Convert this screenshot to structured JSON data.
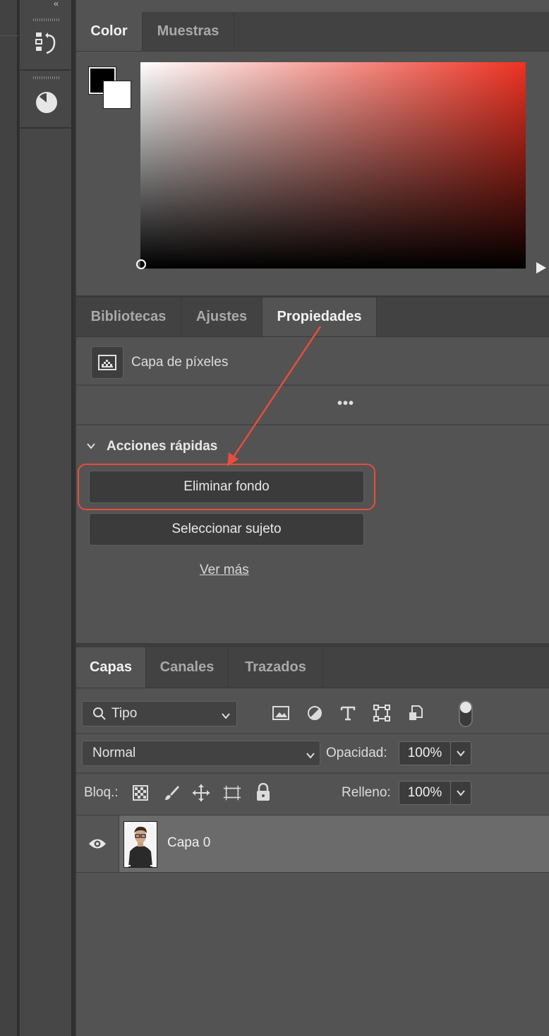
{
  "dock": {
    "icons": [
      "history-icon",
      "color-wheel-icon"
    ]
  },
  "color_panel": {
    "tabs": [
      "Color",
      "Muestras"
    ],
    "active_tab": "Color",
    "foreground_color": "#000000",
    "background_color": "#ffffff",
    "field_hue_color": "#ee3222"
  },
  "properties_panel": {
    "tabs": [
      "Bibliotecas",
      "Ajustes",
      "Propiedades"
    ],
    "active_tab": "Propiedades",
    "layer_type": "Capa de píxeles",
    "more_label": "•••",
    "quick_actions": {
      "title": "Acciones rápidas",
      "remove_bg": "Eliminar fondo",
      "select_subject": "Seleccionar sujeto",
      "see_more": "Ver más"
    },
    "highlight_color": "#e84c3d"
  },
  "layers_panel": {
    "tabs": [
      "Capas",
      "Canales",
      "Trazados"
    ],
    "active_tab": "Capas",
    "filter": {
      "label": "Tipo"
    },
    "blend_mode": "Normal",
    "opacity_label": "Opacidad:",
    "opacity_value": "100%",
    "lock_label": "Bloq.:",
    "fill_label": "Relleno:",
    "fill_value": "100%",
    "layers": [
      {
        "name": "Capa 0",
        "visible": true
      }
    ]
  }
}
